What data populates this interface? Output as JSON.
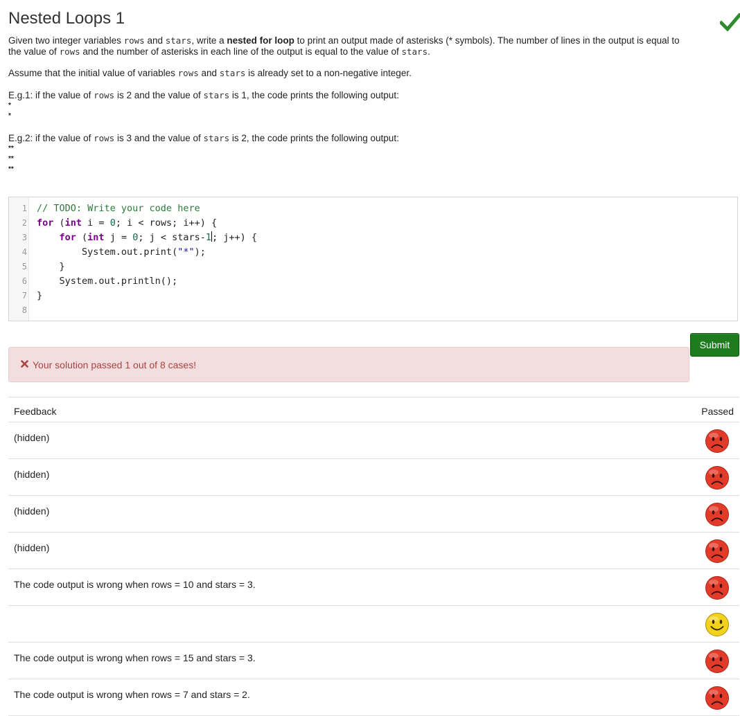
{
  "page": {
    "title": "Nested Loops 1"
  },
  "description": {
    "p1": {
      "t1": "Given two integer variables ",
      "c1": "rows",
      "t2": " and ",
      "c2": "stars",
      "t3": ", write a ",
      "b1": "nested for loop",
      "t4": " to print an output made of asterisks (* symbols). The number of lines in the output is equal to",
      "t5": "the value of ",
      "c3": "rows",
      "t6": " and the number of asterisks in each line of the output is equal to the value of ",
      "c4": "stars",
      "t7": "."
    },
    "p2": {
      "t1": "Assume that the initial value of variables ",
      "c1": "rows",
      "t2": " and ",
      "c2": "stars",
      "t3": " is already set to a non-negative integer."
    },
    "eg1": {
      "t1": "E.g.1: if the value of ",
      "c1": "rows",
      "t2": " is 2 and the value of ",
      "c2": "stars",
      "t3": " is 1, the code prints the following output:",
      "output": [
        "*",
        "*"
      ]
    },
    "eg2": {
      "t1": "E.g.2: if the value of ",
      "c1": "rows",
      "t2": " is 3 and the value of ",
      "c2": "stars",
      "t3": " is 2, the code prints the following output:",
      "output": [
        "**",
        "**",
        "**"
      ]
    }
  },
  "editor": {
    "line_numbers": [
      "1",
      "2",
      "3",
      "4",
      "5",
      "6",
      "7",
      "8"
    ],
    "lines": {
      "l1": "// TODO: Write your code here",
      "l2_kw": "for",
      "l2_a": " (",
      "l2_kw2": "int",
      "l2_b": " i = ",
      "l2_n": "0",
      "l2_c": "; i < rows; i++) {",
      "l3_indent": "    ",
      "l3_kw": "for",
      "l3_a": " (",
      "l3_kw2": "int",
      "l3_b": " j = ",
      "l3_n": "0",
      "l3_c": "; j < stars-",
      "l3_n2": "1",
      "l3_d": "; j++) {",
      "l4_a": "        System.out.print(",
      "l4_s": "\"*\"",
      "l4_b": ");",
      "l5": "    }",
      "l6": "    System.out.println();",
      "l7": "}",
      "l8": ""
    }
  },
  "submit": {
    "label": "Submit"
  },
  "alert": {
    "text": "Your solution passed 1 out of 8 cases!",
    "color": "#a94442",
    "background": "#f2dede"
  },
  "results": {
    "header_feedback": "Feedback",
    "header_passed": "Passed",
    "rows": [
      {
        "feedback": "(hidden)",
        "passed": false
      },
      {
        "feedback": "(hidden)",
        "passed": false
      },
      {
        "feedback": "(hidden)",
        "passed": false
      },
      {
        "feedback": "(hidden)",
        "passed": false
      },
      {
        "feedback": "The code output is wrong when rows = 10 and stars = 3.",
        "passed": false
      },
      {
        "feedback": "",
        "passed": true
      },
      {
        "feedback": "The code output is wrong when rows = 15 and stars = 3.",
        "passed": false
      },
      {
        "feedback": "The code output is wrong when rows = 7 and stars = 2.",
        "passed": false
      }
    ]
  },
  "icons": {
    "title_status": "check-icon",
    "fail": "sad-face-icon",
    "pass": "smiley-face-icon",
    "alert": "x-icon"
  },
  "colors": {
    "check": "#2e8b2e",
    "submit": "#1e7b1e",
    "sad_face": "#e23b2a",
    "happy_face": "#f2d21a"
  }
}
